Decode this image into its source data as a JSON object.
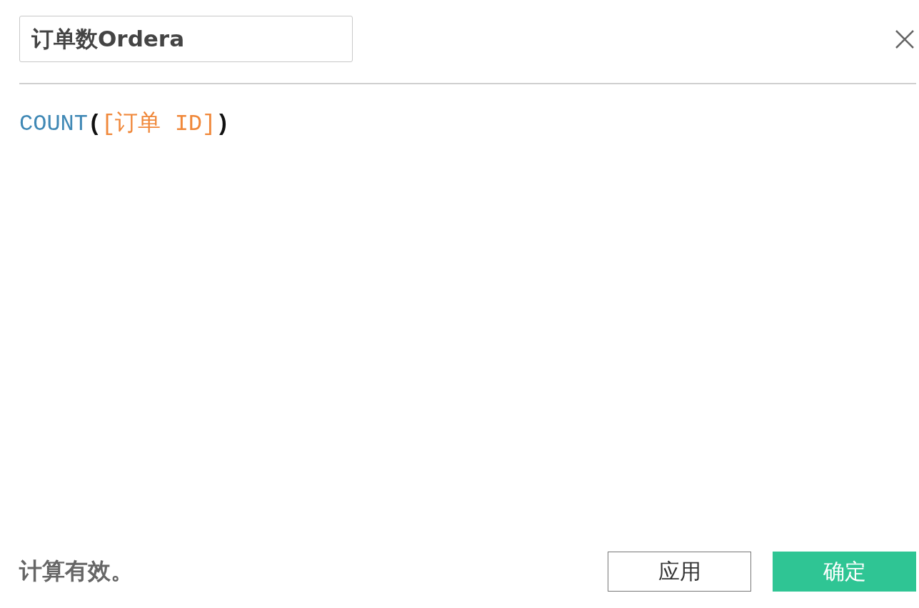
{
  "dialog": {
    "name_field": {
      "value": "订单数Ordera"
    },
    "formula": [
      {
        "kind": "function",
        "text": "COUNT"
      },
      {
        "kind": "paren",
        "text": "("
      },
      {
        "kind": "field",
        "text": "[订单 ID]"
      },
      {
        "kind": "paren",
        "text": ")"
      }
    ],
    "status": "计算有效。",
    "buttons": [
      {
        "kind": "secondary",
        "label": "应用"
      },
      {
        "kind": "primary",
        "label": "确定"
      }
    ]
  }
}
